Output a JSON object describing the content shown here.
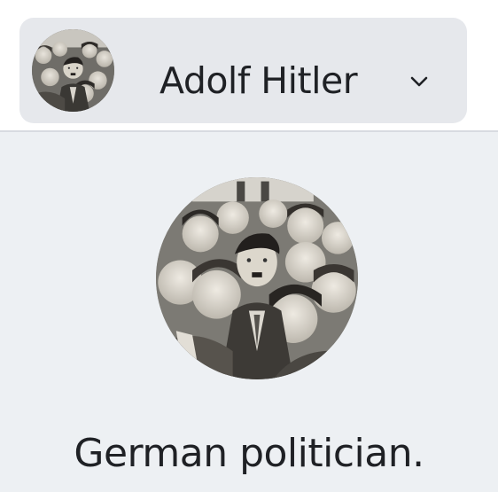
{
  "entity": {
    "name": "Adolf Hitler",
    "description": "German politician.",
    "avatar_icon": "portrait-photo",
    "dropdown_icon": "chevron-down-icon"
  },
  "colors": {
    "switcher_bg": "#e6e8ec",
    "panel_bg": "#edf0f3",
    "text": "#1f2125",
    "divider": "#d8dbe0"
  }
}
